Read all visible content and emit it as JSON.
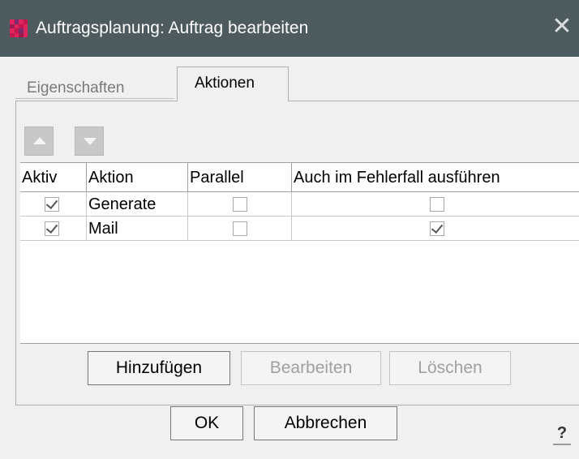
{
  "window": {
    "title": "Auftragsplanung: Auftrag bearbeiten",
    "close_glyph": "✕",
    "icon": "app-grid-icon",
    "titlebar_color": "#4d5a5e",
    "icon_colors": [
      "#e0245e",
      "#7d2b6b",
      "#c4174f",
      "#9b1d4f"
    ]
  },
  "tabs": [
    {
      "label": "Eigenschaften",
      "active": false
    },
    {
      "label": "Aktionen",
      "active": true
    }
  ],
  "toolbar": {
    "move_up_icon": "arrow-up-icon",
    "move_down_icon": "arrow-down-icon"
  },
  "table": {
    "columns": [
      "Aktiv",
      "Aktion",
      "Parallel",
      "Auch im Fehlerfall ausführen"
    ],
    "rows": [
      {
        "aktiv": true,
        "aktion": "Generate",
        "parallel": false,
        "fehlerfall": false
      },
      {
        "aktiv": true,
        "aktion": "Mail",
        "parallel": false,
        "fehlerfall": true
      }
    ]
  },
  "actions": {
    "add_label": "Hinzufügen",
    "edit_label": "Bearbeiten",
    "delete_label": "Löschen"
  },
  "footer": {
    "ok_label": "OK",
    "cancel_label": "Abbrechen",
    "help_label": "?"
  }
}
